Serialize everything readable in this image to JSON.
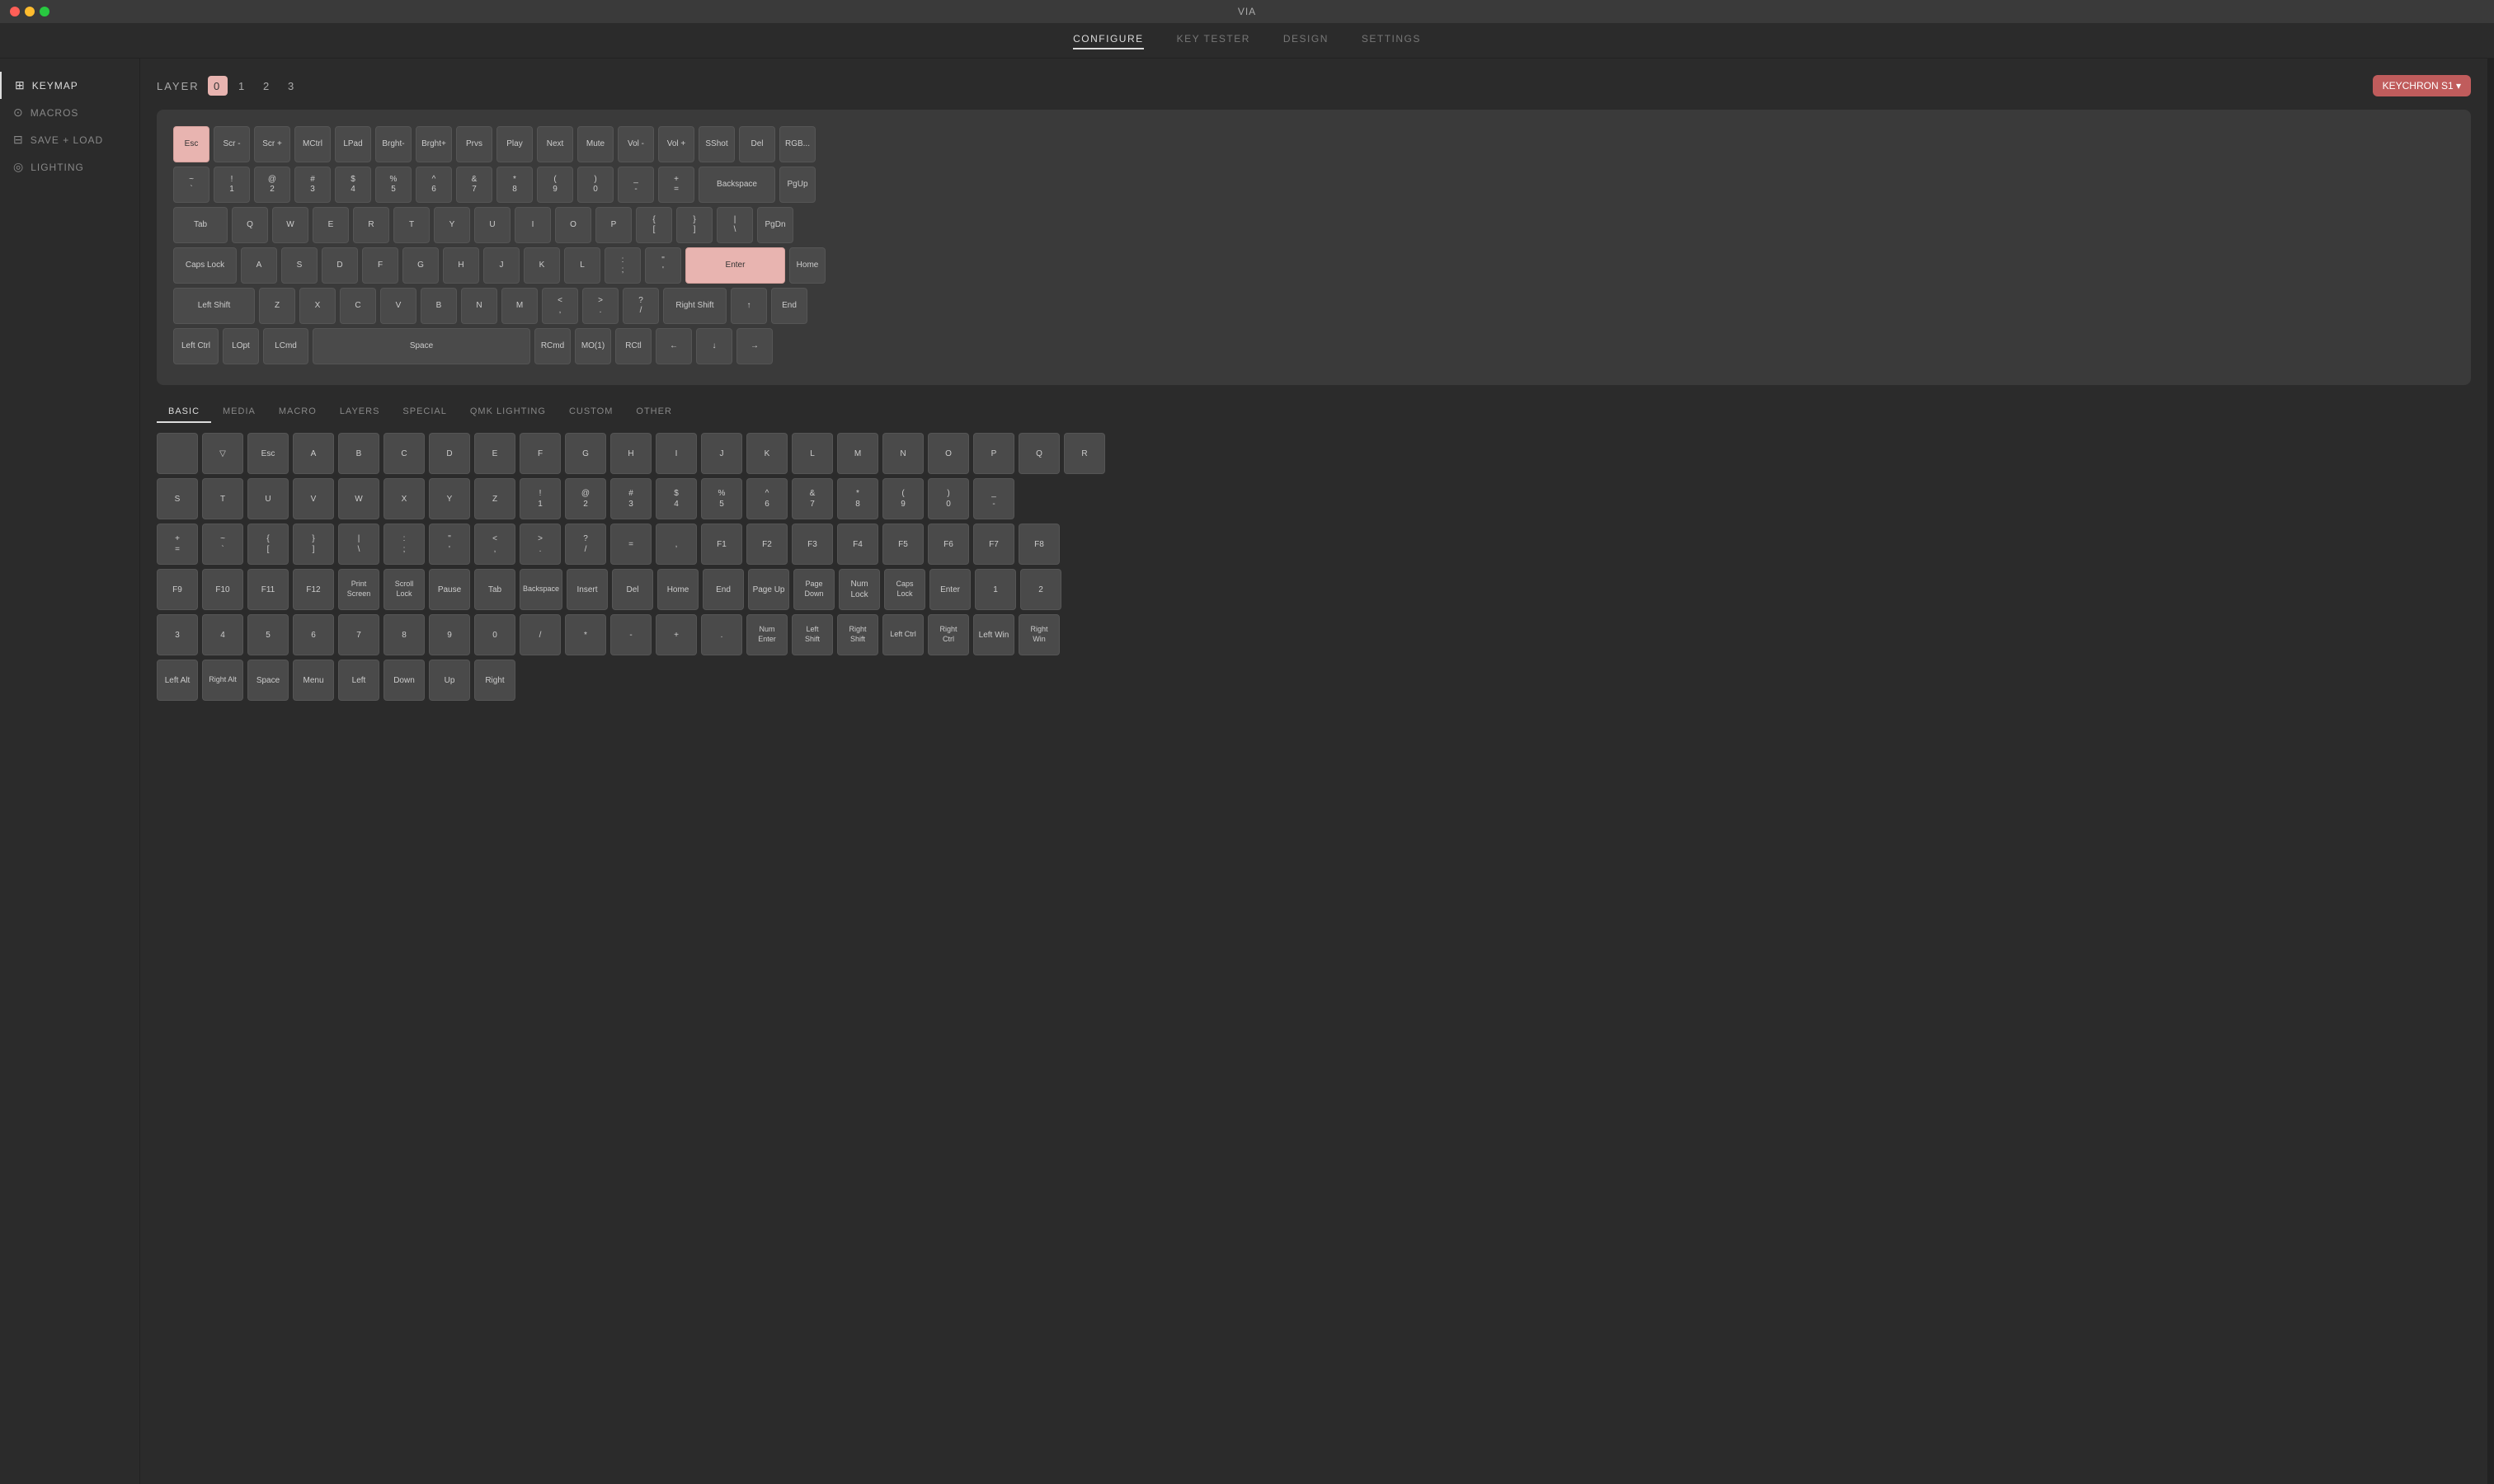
{
  "titlebar": {
    "title": "VIA"
  },
  "nav": {
    "items": [
      {
        "label": "CONFIGURE",
        "active": true
      },
      {
        "label": "KEY TESTER",
        "active": false
      },
      {
        "label": "DESIGN",
        "active": false
      },
      {
        "label": "SETTINGS",
        "active": false
      }
    ]
  },
  "sidebar": {
    "items": [
      {
        "id": "keymap",
        "icon": "⊞",
        "label": "KEYMAP",
        "active": true
      },
      {
        "id": "macros",
        "icon": "⊙",
        "label": "MACROS",
        "active": false
      },
      {
        "id": "save-load",
        "icon": "⊟",
        "label": "SAVE + LOAD",
        "active": false
      },
      {
        "id": "lighting",
        "icon": "◎",
        "label": "LIGHTING",
        "active": false
      }
    ]
  },
  "configure": {
    "layer_label": "LAYER",
    "layers": [
      "0",
      "1",
      "2",
      "3"
    ],
    "active_layer": 0,
    "keyboard_name": "KEYCHRON S1 ▾"
  },
  "keyboard_rows": [
    [
      {
        "label": "Esc",
        "width": "w1",
        "highlighted": true
      },
      {
        "label": "Scr -",
        "width": "w1"
      },
      {
        "label": "Scr +",
        "width": "w1"
      },
      {
        "label": "MCtrl",
        "width": "w1"
      },
      {
        "label": "LPad",
        "width": "w1"
      },
      {
        "label": "Brght-",
        "width": "w1"
      },
      {
        "label": "Brght+",
        "width": "w1"
      },
      {
        "label": "Prvs",
        "width": "w1"
      },
      {
        "label": "Play",
        "width": "w1"
      },
      {
        "label": "Next",
        "width": "w1"
      },
      {
        "label": "Mute",
        "width": "w1"
      },
      {
        "label": "Vol -",
        "width": "w1"
      },
      {
        "label": "Vol +",
        "width": "w1"
      },
      {
        "label": "SShot",
        "width": "w1"
      },
      {
        "label": "Del",
        "width": "w1"
      },
      {
        "label": "RGB...",
        "width": "w1"
      }
    ],
    [
      {
        "label": "~\n`",
        "width": "w1"
      },
      {
        "label": "!\n1",
        "width": "w1"
      },
      {
        "label": "@\n2",
        "width": "w1"
      },
      {
        "label": "#\n3",
        "width": "w1"
      },
      {
        "label": "$\n4",
        "width": "w1"
      },
      {
        "label": "%\n5",
        "width": "w1"
      },
      {
        "label": "^\n6",
        "width": "w1"
      },
      {
        "label": "&\n7",
        "width": "w1"
      },
      {
        "label": "*\n8",
        "width": "w1"
      },
      {
        "label": "(\n9",
        "width": "w1"
      },
      {
        "label": ")\n0",
        "width": "w1"
      },
      {
        "label": "_\n-",
        "width": "w1"
      },
      {
        "label": "+\n=",
        "width": "w1"
      },
      {
        "label": "Backspace",
        "width": "w2"
      },
      {
        "label": "PgUp",
        "width": "w1"
      }
    ],
    [
      {
        "label": "Tab",
        "width": "w15"
      },
      {
        "label": "Q",
        "width": "w1"
      },
      {
        "label": "W",
        "width": "w1"
      },
      {
        "label": "E",
        "width": "w1"
      },
      {
        "label": "R",
        "width": "w1"
      },
      {
        "label": "T",
        "width": "w1"
      },
      {
        "label": "Y",
        "width": "w1"
      },
      {
        "label": "U",
        "width": "w1"
      },
      {
        "label": "I",
        "width": "w1"
      },
      {
        "label": "O",
        "width": "w1"
      },
      {
        "label": "P",
        "width": "w1"
      },
      {
        "label": "{\n[",
        "width": "w1"
      },
      {
        "label": "}\n]",
        "width": "w1"
      },
      {
        "label": "|\n\\",
        "width": "w1"
      },
      {
        "label": "PgDn",
        "width": "w1"
      }
    ],
    [
      {
        "label": "Caps Lock",
        "width": "w175"
      },
      {
        "label": "A",
        "width": "w1"
      },
      {
        "label": "S",
        "width": "w1"
      },
      {
        "label": "D",
        "width": "w1"
      },
      {
        "label": "F",
        "width": "w1"
      },
      {
        "label": "G",
        "width": "w1"
      },
      {
        "label": "H",
        "width": "w1"
      },
      {
        "label": "J",
        "width": "w1"
      },
      {
        "label": "K",
        "width": "w1"
      },
      {
        "label": "L",
        "width": "w1"
      },
      {
        "label": ":\n;",
        "width": "w1"
      },
      {
        "label": "\"\n'",
        "width": "w1"
      },
      {
        "label": "Enter",
        "width": "w275",
        "enter": true
      },
      {
        "label": "Home",
        "width": "w1"
      }
    ],
    [
      {
        "label": "Left Shift",
        "width": "w225"
      },
      {
        "label": "Z",
        "width": "w1"
      },
      {
        "label": "X",
        "width": "w1"
      },
      {
        "label": "C",
        "width": "w1"
      },
      {
        "label": "V",
        "width": "w1"
      },
      {
        "label": "B",
        "width": "w1"
      },
      {
        "label": "N",
        "width": "w1"
      },
      {
        "label": "M",
        "width": "w1"
      },
      {
        "label": "<\n,",
        "width": "w1"
      },
      {
        "label": ">\n.",
        "width": "w1"
      },
      {
        "label": "?\n/",
        "width": "w1"
      },
      {
        "label": "Right Shift",
        "width": "w175"
      },
      {
        "label": "↑",
        "width": "w1"
      },
      {
        "label": "End",
        "width": "w1"
      }
    ],
    [
      {
        "label": "Left Ctrl",
        "width": "w125"
      },
      {
        "label": "LOpt",
        "width": "w1"
      },
      {
        "label": "LCmd",
        "width": "w125"
      },
      {
        "label": "Space",
        "width": "w6"
      },
      {
        "label": "RCmd",
        "width": "w1"
      },
      {
        "label": "MO(1)",
        "width": "w1"
      },
      {
        "label": "RCtl",
        "width": "w1"
      },
      {
        "label": "←",
        "width": "w1"
      },
      {
        "label": "↓",
        "width": "w1"
      },
      {
        "label": "→",
        "width": "w1"
      }
    ]
  ],
  "picker_tabs": [
    {
      "label": "BASIC",
      "active": true
    },
    {
      "label": "MEDIA",
      "active": false
    },
    {
      "label": "MACRO",
      "active": false
    },
    {
      "label": "LAYERS",
      "active": false
    },
    {
      "label": "SPECIAL",
      "active": false
    },
    {
      "label": "QMK LIGHTING",
      "active": false
    },
    {
      "label": "CUSTOM",
      "active": false
    },
    {
      "label": "OTHER",
      "active": false
    }
  ],
  "picker_rows": [
    [
      {
        "label": "",
        "width": "w1"
      },
      {
        "label": "▽",
        "width": "w1"
      },
      {
        "label": "Esc",
        "width": "w1"
      },
      {
        "label": "A",
        "width": "w1"
      },
      {
        "label": "B",
        "width": "w1"
      },
      {
        "label": "C",
        "width": "w1"
      },
      {
        "label": "D",
        "width": "w1"
      },
      {
        "label": "E",
        "width": "w1"
      },
      {
        "label": "F",
        "width": "w1"
      },
      {
        "label": "G",
        "width": "w1"
      },
      {
        "label": "H",
        "width": "w1"
      },
      {
        "label": "I",
        "width": "w1"
      },
      {
        "label": "J",
        "width": "w1"
      },
      {
        "label": "K",
        "width": "w1"
      },
      {
        "label": "L",
        "width": "w1"
      },
      {
        "label": "M",
        "width": "w1"
      },
      {
        "label": "N",
        "width": "w1"
      },
      {
        "label": "O",
        "width": "w1"
      },
      {
        "label": "P",
        "width": "w1"
      },
      {
        "label": "Q",
        "width": "w1"
      },
      {
        "label": "R",
        "width": "w1"
      }
    ],
    [
      {
        "label": "S",
        "width": "w1"
      },
      {
        "label": "T",
        "width": "w1"
      },
      {
        "label": "U",
        "width": "w1"
      },
      {
        "label": "V",
        "width": "w1"
      },
      {
        "label": "W",
        "width": "w1"
      },
      {
        "label": "X",
        "width": "w1"
      },
      {
        "label": "Y",
        "width": "w1"
      },
      {
        "label": "Z",
        "width": "w1"
      },
      {
        "label": "!\n1",
        "width": "w1"
      },
      {
        "label": "@\n2",
        "width": "w1"
      },
      {
        "label": "#\n3",
        "width": "w1"
      },
      {
        "label": "$\n4",
        "width": "w1"
      },
      {
        "label": "%\n5",
        "width": "w1"
      },
      {
        "label": "^\n6",
        "width": "w1"
      },
      {
        "label": "&\n7",
        "width": "w1"
      },
      {
        "label": "*\n8",
        "width": "w1"
      },
      {
        "label": "(\n9",
        "width": "w1"
      },
      {
        "label": ")\n0",
        "width": "w1"
      },
      {
        "label": "_\n-",
        "width": "w1"
      }
    ],
    [
      {
        "label": "+\n=",
        "width": "w1"
      },
      {
        "label": "~\n`",
        "width": "w1"
      },
      {
        "label": "{\n[",
        "width": "w1"
      },
      {
        "label": "}\n]",
        "width": "w1"
      },
      {
        "label": "|\n\\",
        "width": "w1"
      },
      {
        "label": ":\n;",
        "width": "w1"
      },
      {
        "label": "\"\n'",
        "width": "w1"
      },
      {
        "label": "<\n,",
        "width": "w1"
      },
      {
        "label": ">\n.",
        "width": "w1"
      },
      {
        "label": "?\n/",
        "width": "w1"
      },
      {
        "label": "=",
        "width": "w1"
      },
      {
        "label": ",",
        "width": "w1"
      },
      {
        "label": "F1",
        "width": "w1"
      },
      {
        "label": "F2",
        "width": "w1"
      },
      {
        "label": "F3",
        "width": "w1"
      },
      {
        "label": "F4",
        "width": "w1"
      },
      {
        "label": "F5",
        "width": "w1"
      },
      {
        "label": "F6",
        "width": "w1"
      },
      {
        "label": "F7",
        "width": "w1"
      },
      {
        "label": "F8",
        "width": "w1"
      }
    ],
    [
      {
        "label": "F9",
        "width": "w1"
      },
      {
        "label": "F10",
        "width": "w1"
      },
      {
        "label": "F11",
        "width": "w1"
      },
      {
        "label": "F12",
        "width": "w1"
      },
      {
        "label": "Print\nScreen",
        "width": "w1"
      },
      {
        "label": "Scroll\nLock",
        "width": "w1"
      },
      {
        "label": "Pause",
        "width": "w1"
      },
      {
        "label": "Tab",
        "width": "w1"
      },
      {
        "label": "Backspace",
        "width": "w1"
      },
      {
        "label": "Insert",
        "width": "w1"
      },
      {
        "label": "Del",
        "width": "w1"
      },
      {
        "label": "Home",
        "width": "w1"
      },
      {
        "label": "End",
        "width": "w1"
      },
      {
        "label": "Page Up",
        "width": "w1"
      },
      {
        "label": "Page\nDown",
        "width": "w1"
      },
      {
        "label": "Num\nLock",
        "width": "w1"
      },
      {
        "label": "Caps\nLock",
        "width": "w1"
      },
      {
        "label": "Enter",
        "width": "w1"
      },
      {
        "label": "1",
        "width": "w1"
      },
      {
        "label": "2",
        "width": "w1"
      }
    ],
    [
      {
        "label": "3",
        "width": "w1"
      },
      {
        "label": "4",
        "width": "w1"
      },
      {
        "label": "5",
        "width": "w1"
      },
      {
        "label": "6",
        "width": "w1"
      },
      {
        "label": "7",
        "width": "w1"
      },
      {
        "label": "8",
        "width": "w1"
      },
      {
        "label": "9",
        "width": "w1"
      },
      {
        "label": "0",
        "width": "w1"
      },
      {
        "label": "/",
        "width": "w1"
      },
      {
        "label": "*",
        "width": "w1"
      },
      {
        "label": "-",
        "width": "w1"
      },
      {
        "label": "+",
        "width": "w1"
      },
      {
        "label": ".",
        "width": "w1"
      },
      {
        "label": "Num\nEnter",
        "width": "w1"
      },
      {
        "label": "Left\nShift",
        "width": "w1"
      },
      {
        "label": "Right\nShift",
        "width": "w1"
      },
      {
        "label": "Left Ctrl",
        "width": "w1"
      },
      {
        "label": "Right\nCtrl",
        "width": "w1"
      },
      {
        "label": "Left Win",
        "width": "w1"
      },
      {
        "label": "Right\nWin",
        "width": "w1"
      }
    ],
    [
      {
        "label": "Left Alt",
        "width": "w1"
      },
      {
        "label": "Right Alt",
        "width": "w1"
      },
      {
        "label": "Space",
        "width": "w1"
      },
      {
        "label": "Menu",
        "width": "w1"
      },
      {
        "label": "Left",
        "width": "w1"
      },
      {
        "label": "Down",
        "width": "w1"
      },
      {
        "label": "Up",
        "width": "w1"
      },
      {
        "label": "Right",
        "width": "w1"
      }
    ]
  ]
}
